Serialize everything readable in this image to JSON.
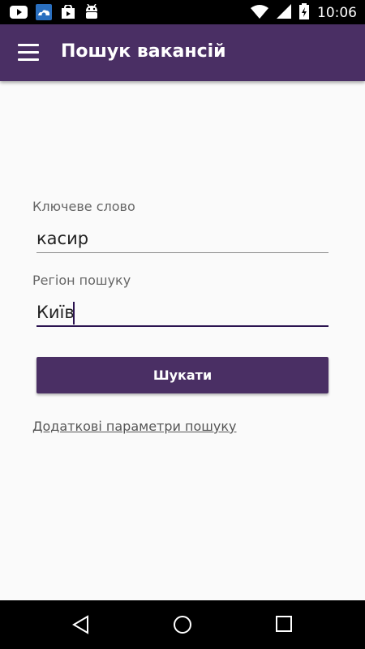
{
  "status_bar": {
    "time": "10:06",
    "left_icons": [
      "youtube-icon",
      "cloud-gear-icon",
      "play-store-icon",
      "android-icon"
    ],
    "right_icons": [
      "wifi-icon",
      "signal-icon",
      "battery-charging-icon"
    ]
  },
  "app_bar": {
    "title": "Пошук вакансій",
    "menu_icon": "hamburger-menu-icon",
    "color": "#4a2f64"
  },
  "form": {
    "keyword_label": "Ключеве слово",
    "keyword_value": "касир",
    "region_label": "Регіон пошуку",
    "region_value": "Київ",
    "search_button": "Шукати",
    "advanced_link": "Додаткові параметри пошуку"
  },
  "nav_bar": {
    "buttons": [
      "back-icon",
      "home-icon",
      "recents-icon"
    ]
  }
}
